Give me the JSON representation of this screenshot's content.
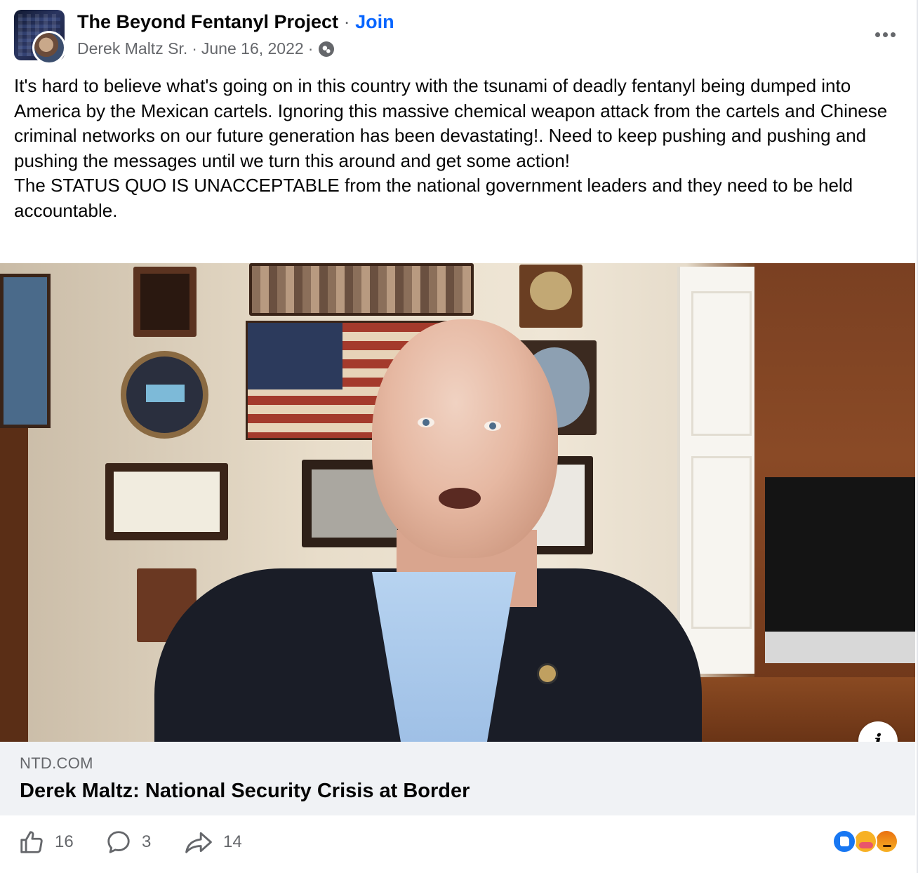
{
  "post": {
    "group_name": "The Beyond Fentanyl Project",
    "separator": "·",
    "join_label": "Join",
    "author": "Derek Maltz Sr.",
    "date": "June 16, 2022",
    "privacy_icon": "globe-icon",
    "more_icon": "more-horizontal-icon",
    "text_paragraph_1": "It's hard to believe what's going on in this country with the tsunami of deadly fentanyl being dumped into America by the Mexican cartels. Ignoring this massive chemical weapon attack from the cartels and Chinese criminal networks on our future generation has been devastating!. Need to keep pushing and pushing and pushing the messages until we turn this around and get some action!",
    "text_paragraph_2": "The STATUS QUO IS UNACCEPTABLE from the national government leaders and they need to be held accountable."
  },
  "link_preview": {
    "domain": "NTD.COM",
    "title": "Derek Maltz: National Security Crisis at Border",
    "info_icon": "info-icon"
  },
  "actions": {
    "like_count": "16",
    "comment_count": "3",
    "share_count": "14",
    "like_icon": "thumbs-up-icon",
    "comment_icon": "comment-bubble-icon",
    "share_icon": "share-arrow-icon"
  },
  "reactions": [
    "like-reaction-icon",
    "care-reaction-icon",
    "angry-reaction-icon"
  ],
  "colors": {
    "join_link": "#0866ff",
    "meta_text": "#65676b",
    "footer_bg": "#f0f2f5",
    "like_blue": "#1877f2"
  }
}
